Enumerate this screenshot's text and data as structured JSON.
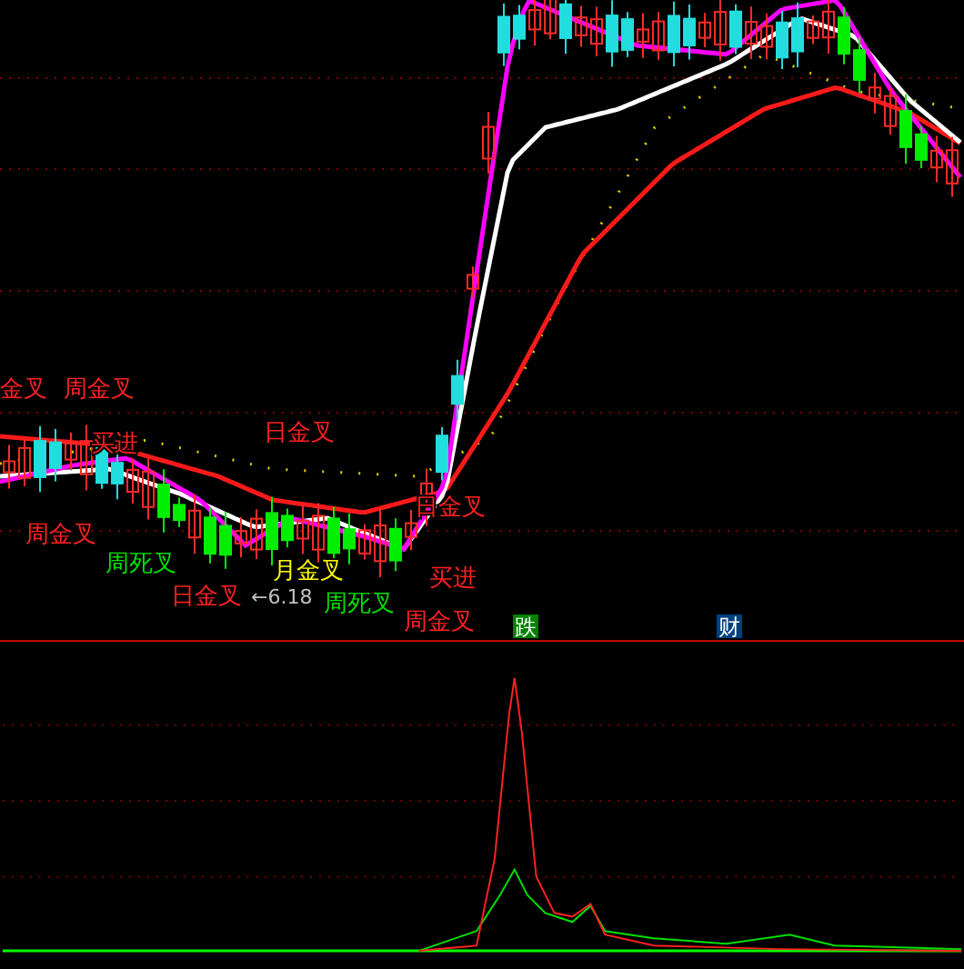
{
  "price_panel": {
    "signals": [
      {
        "text": "金叉",
        "color": "#ff2020"
      },
      {
        "text": "周金叉",
        "color": "#ff2020"
      },
      {
        "text": "周金叉",
        "color": "#ff2020"
      },
      {
        "text": "买进",
        "color": "#ff2020"
      },
      {
        "text": "日金叉",
        "color": "#ff2020"
      },
      {
        "text": "周死叉",
        "color": "#00e000"
      },
      {
        "text": "日金叉",
        "color": "#ff2020"
      },
      {
        "text": "月金叉",
        "color": "#ffff00"
      },
      {
        "text": "周死叉",
        "color": "#00e000"
      },
      {
        "text": "日金叉",
        "color": "#ff2020"
      },
      {
        "text": "买进",
        "color": "#ff2020"
      },
      {
        "text": "周金叉",
        "color": "#ff2020"
      }
    ],
    "low_marker": "←6.18"
  },
  "indicator_panel": {
    "markers": [
      {
        "text": "跌",
        "color": "#008000"
      },
      {
        "text": "财",
        "color": "#004080"
      }
    ]
  }
}
